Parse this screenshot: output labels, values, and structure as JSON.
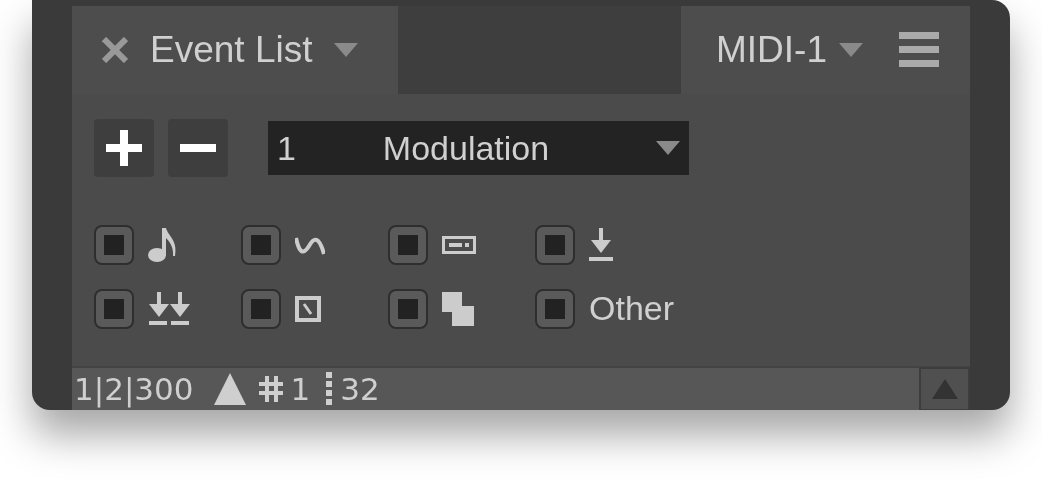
{
  "tabs": [
    {
      "label": "Event List",
      "selected": true
    }
  ],
  "header_right": {
    "label": "MIDI-1"
  },
  "toolbar": {
    "controller": {
      "number": "1",
      "name": "Modulation"
    }
  },
  "filters": [
    {
      "kind": "note",
      "checked": false
    },
    {
      "kind": "curve",
      "checked": false
    },
    {
      "kind": "bar",
      "checked": false
    },
    {
      "kind": "arrow",
      "checked": false
    },
    {
      "kind": "double-arrow",
      "checked": false
    },
    {
      "kind": "slash-box",
      "checked": false
    },
    {
      "kind": "squares",
      "checked": false
    },
    {
      "kind": "text",
      "label": "Other",
      "checked": false
    }
  ],
  "status_bar": {
    "position": "1|2|300",
    "channel": "1",
    "value": "32"
  }
}
